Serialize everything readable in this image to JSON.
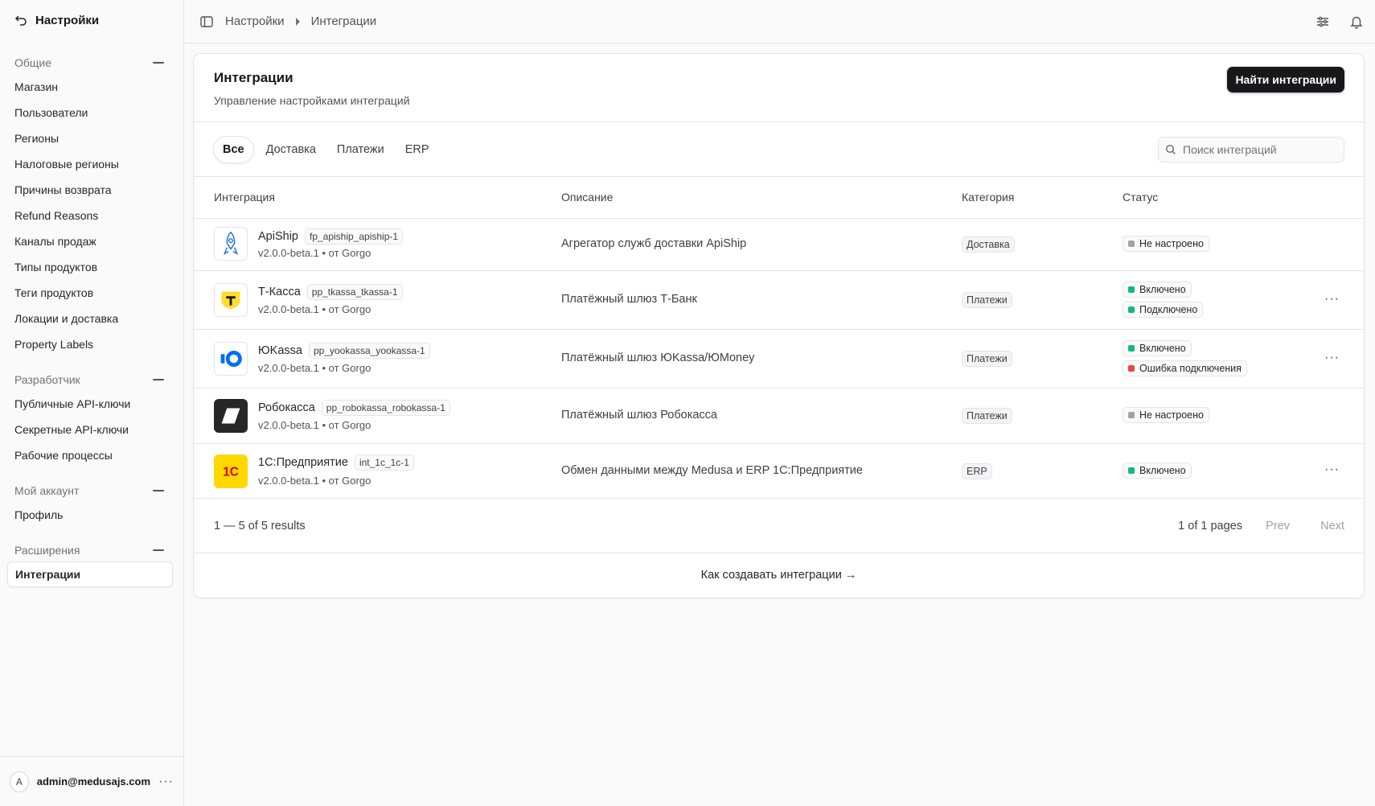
{
  "sidebar": {
    "back_label": "Настройки",
    "sections": [
      {
        "title": "Общие",
        "items": [
          "Магазин",
          "Пользователи",
          "Регионы",
          "Налоговые регионы",
          "Причины возврата",
          "Refund Reasons",
          "Каналы продаж",
          "Типы продуктов",
          "Теги продуктов",
          "Локации и доставка",
          "Property Labels"
        ]
      },
      {
        "title": "Разработчик",
        "items": [
          "Публичные API-ключи",
          "Секретные API-ключи",
          "Рабочие процессы"
        ]
      },
      {
        "title": "Мой аккаунт",
        "items": [
          "Профиль"
        ]
      },
      {
        "title": "Расширения",
        "items": [
          "Интеграции"
        ]
      }
    ],
    "user": {
      "initial": "A",
      "email": "admin@medusajs.com"
    }
  },
  "topbar": {
    "crumbs": [
      "Настройки",
      "Интеграции"
    ]
  },
  "page": {
    "title": "Интеграции",
    "subtitle": "Управление настройками интеграций",
    "find_button": "Найти интеграции",
    "tabs": [
      "Все",
      "Доставка",
      "Платежи",
      "ERP"
    ],
    "search_placeholder": "Поиск интеграций",
    "columns": [
      "Интеграция",
      "Описание",
      "Категория",
      "Статус"
    ],
    "rows": [
      {
        "name": "ApiShip",
        "code": "fp_apiship_apiship-1",
        "version": "v2.0.0-beta.1 • от Gorgo",
        "description": "Агрегатор служб доставки ApiShip",
        "category": "Доставка",
        "statuses": [
          {
            "label": "Не настроено",
            "color": "#a1a1aa"
          }
        ],
        "menu": false
      },
      {
        "name": "Т-Касса",
        "code": "pp_tkassa_tkassa-1",
        "version": "v2.0.0-beta.1 • от Gorgo",
        "description": "Платёжный шлюз Т-Банк",
        "category": "Платежи",
        "statuses": [
          {
            "label": "Включено",
            "color": "#10b981"
          },
          {
            "label": "Подключено",
            "color": "#10b981"
          }
        ],
        "menu": true
      },
      {
        "name": "ЮKassa",
        "code": "pp_yookassa_yookassa-1",
        "version": "v2.0.0-beta.1 • от Gorgo",
        "description": "Платёжный шлюз ЮKassa/ЮMoney",
        "category": "Платежи",
        "statuses": [
          {
            "label": "Включено",
            "color": "#10b981"
          },
          {
            "label": "Ошибка подключения",
            "color": "#ef4444"
          }
        ],
        "menu": true
      },
      {
        "name": "Робокасса",
        "code": "pp_robokassa_robokassa-1",
        "version": "v2.0.0-beta.1 • от Gorgo",
        "description": "Платёжный шлюз Робокасса",
        "category": "Платежи",
        "statuses": [
          {
            "label": "Не настроено",
            "color": "#a1a1aa"
          }
        ],
        "menu": false
      },
      {
        "name": "1С:Предприятие",
        "code": "int_1c_1c-1",
        "version": "v2.0.0-beta.1 • от Gorgo",
        "description": "Обмен данными между Medusa и ERP 1С:Предприятие",
        "category": "ERP",
        "statuses": [
          {
            "label": "Включено",
            "color": "#10b981"
          }
        ],
        "menu": true
      }
    ],
    "pagination": {
      "count": "1 — 5 of 5 results",
      "pages": "1 of 1 pages",
      "prev": "Prev",
      "next": "Next"
    },
    "footer_link": "Как создавать интеграции →"
  },
  "icons": {
    "back": "undo-arrow-icon",
    "sidebar_toggle": "sidebar-toggle-icon",
    "settings": "sliders-icon",
    "notifications": "bell-icon",
    "search": "search-icon",
    "more": "ellipsis-icon"
  },
  "logos": {
    "tkassa_bg": "#ffdd2d",
    "yookassa": "#0070f0",
    "robokassa_bg": "#27272a",
    "onec_bg": "#ffd800",
    "onec_fg": "#d50000"
  }
}
